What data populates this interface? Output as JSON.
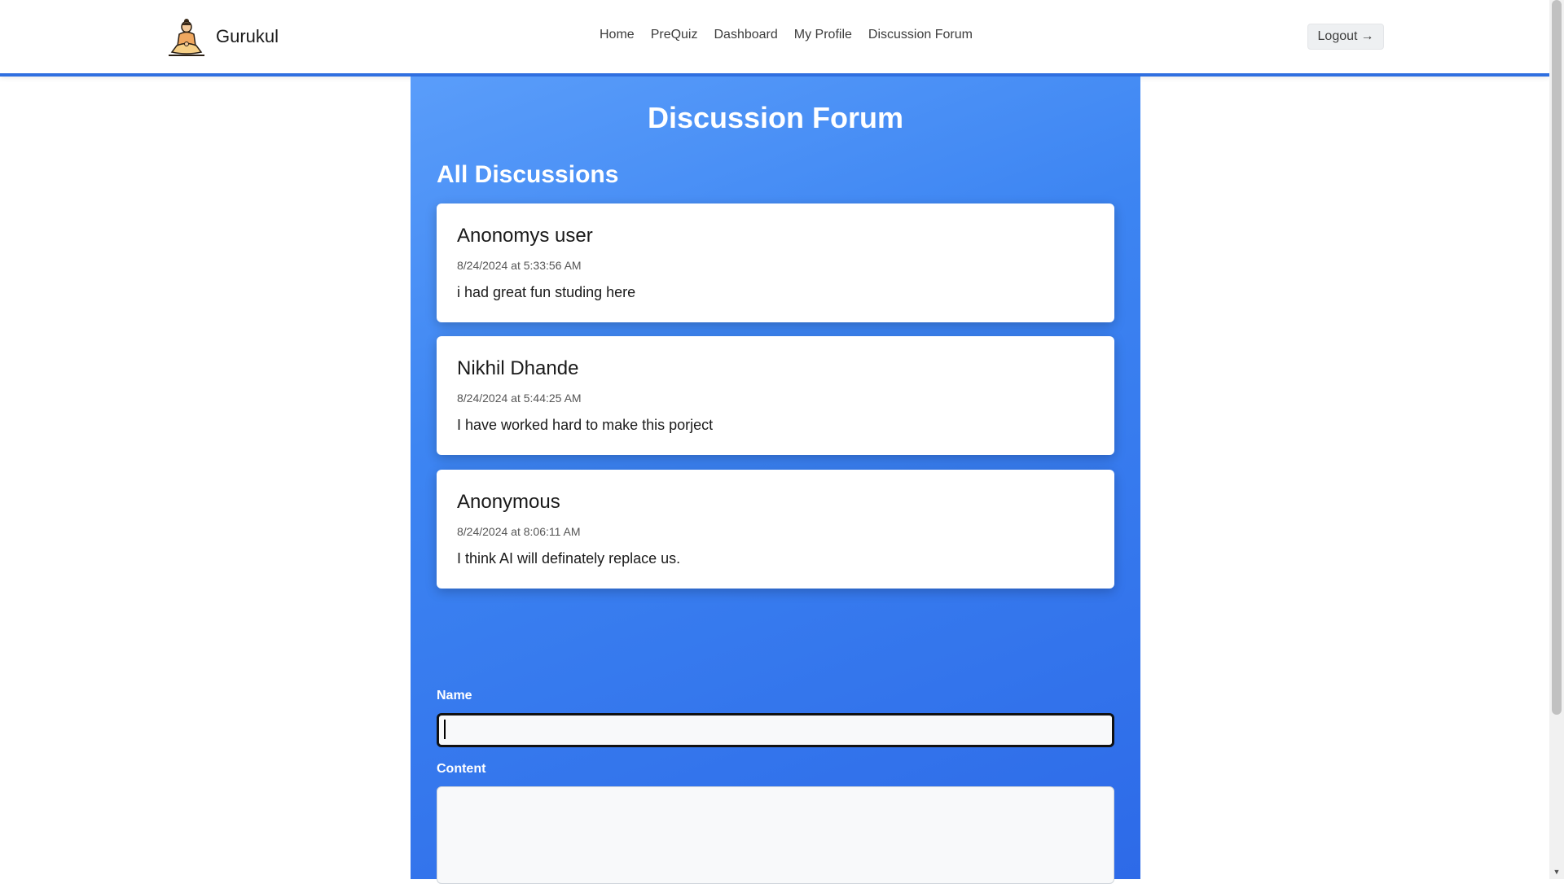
{
  "brand": {
    "name": "Gurukul",
    "logo_icon": "meditating-figure-icon"
  },
  "nav": {
    "items": [
      {
        "label": "Home"
      },
      {
        "label": "PreQuiz"
      },
      {
        "label": "Dashboard"
      },
      {
        "label": "My Profile"
      },
      {
        "label": "Discussion Forum"
      }
    ],
    "logout_label": "Logout",
    "logout_icon": "arrow-right-icon"
  },
  "main": {
    "title": "Discussion Forum",
    "section_title": "All Discussions",
    "discussions": [
      {
        "author": "Anonomys user",
        "timestamp": "8/24/2024 at 5:33:56 AM",
        "content": "i had great fun studing here"
      },
      {
        "author": "Nikhil Dhande",
        "timestamp": "8/24/2024 at 5:44:25 AM",
        "content": "I have worked hard to make this porject"
      },
      {
        "author": "Anonymous",
        "timestamp": "8/24/2024 at 8:06:11 AM",
        "content": "I think AI will definately replace us."
      }
    ]
  },
  "form": {
    "name_label": "Name",
    "name_value": "",
    "content_label": "Content",
    "content_value": ""
  },
  "colors": {
    "accent": "#2f6fe0",
    "panel_gradient_start": "#5a9dfa",
    "panel_gradient_end": "#2d6ae8"
  }
}
